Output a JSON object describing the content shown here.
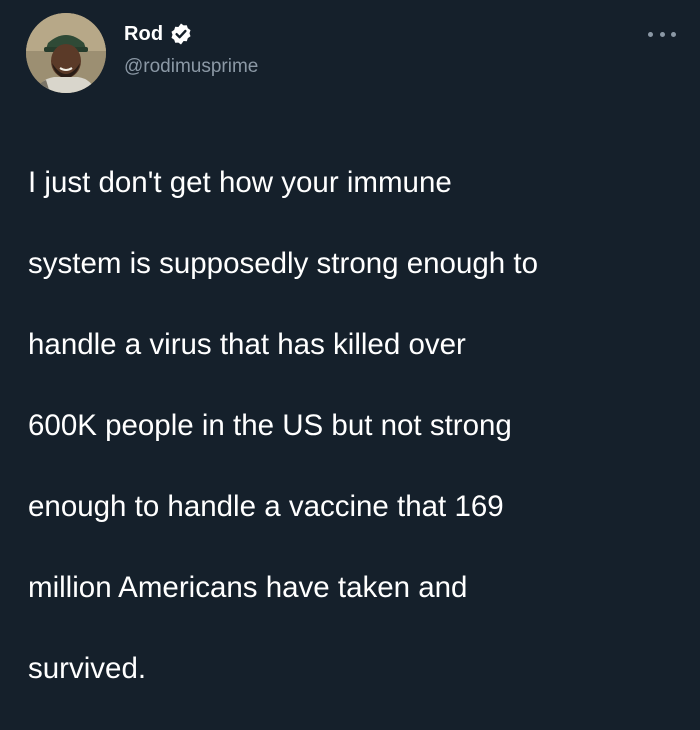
{
  "author": {
    "display_name": "Rod",
    "handle": "@rodimusprime",
    "verified": true,
    "avatar_icon": "profile-photo"
  },
  "tweet": {
    "text_lines": [
      "I just don't get how your immune",
      "system is supposedly strong enough to",
      "handle a virus that has killed over",
      "600K people in the US but not strong",
      "enough to handle a vaccine that 169",
      "million Americans have taken and",
      "survived."
    ]
  },
  "icons": {
    "more": "more-options-icon",
    "verified": "verified-badge-icon"
  },
  "colors": {
    "background": "#15202b",
    "text": "#ffffff",
    "secondary_text": "#8b98a5",
    "verified_badge": "#ffffff"
  }
}
